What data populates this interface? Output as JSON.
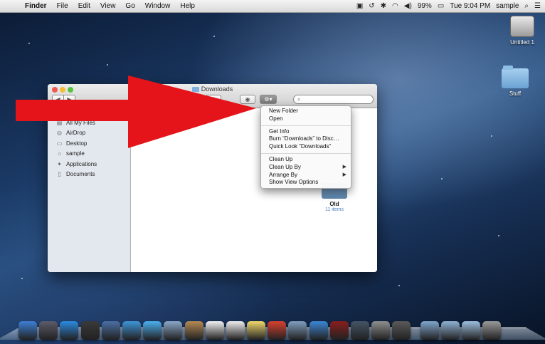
{
  "menubar": {
    "apple_glyph": "",
    "items": [
      "Finder",
      "File",
      "Edit",
      "View",
      "Go",
      "Window",
      "Help"
    ],
    "battery": "99%",
    "clock": "Tue 9:04 PM",
    "user": "sample"
  },
  "desktop": {
    "icons": [
      {
        "label": "Untitled 1",
        "kind": "drive-icon"
      },
      {
        "label": "Stuff",
        "kind": "folder-icon"
      }
    ]
  },
  "finder": {
    "title": "Downloads",
    "sidebar": [
      {
        "label": "All My Files",
        "icon": "all-files-icon"
      },
      {
        "label": "AirDrop",
        "icon": "airdrop-icon"
      },
      {
        "label": "Desktop",
        "icon": "desktop-icon"
      },
      {
        "label": "sample",
        "icon": "home-icon"
      },
      {
        "label": "Applications",
        "icon": "applications-icon"
      },
      {
        "label": "Documents",
        "icon": "documents-icon"
      }
    ],
    "content": {
      "folder_name": "Old",
      "folder_count": "11 items"
    }
  },
  "context_menu": {
    "items": [
      {
        "label": "New Folder"
      },
      {
        "label": "Open"
      },
      {
        "separator": true
      },
      {
        "label": "Get Info"
      },
      {
        "label": "Burn “Downloads” to Disc…"
      },
      {
        "label": "Quick Look “Downloads”"
      },
      {
        "separator": true
      },
      {
        "label": "Clean Up"
      },
      {
        "label": "Clean Up By",
        "submenu": true
      },
      {
        "label": "Arrange By",
        "submenu": true
      },
      {
        "label": "Show View Options"
      }
    ]
  },
  "dock": {
    "icons": [
      {
        "name": "finder",
        "color": "#3d7fd6"
      },
      {
        "name": "launchpad",
        "color": "#5b5b6b"
      },
      {
        "name": "app-store",
        "color": "#2b8ae0"
      },
      {
        "name": "dashboard",
        "color": "#3a3a3a"
      },
      {
        "name": "mission-control",
        "color": "#4a6fa5"
      },
      {
        "name": "safari",
        "color": "#3f95d8"
      },
      {
        "name": "messages",
        "color": "#4bb0f0"
      },
      {
        "name": "mail",
        "color": "#8ba8c8"
      },
      {
        "name": "contacts",
        "color": "#b58a55"
      },
      {
        "name": "calendar",
        "color": "#f2f2f2"
      },
      {
        "name": "reminders",
        "color": "#eeeeee"
      },
      {
        "name": "notes",
        "color": "#f1d96b"
      },
      {
        "name": "chrome",
        "color": "#d8412f"
      },
      {
        "name": "preview",
        "color": "#7f9fbf"
      },
      {
        "name": "itunes",
        "color": "#3d86d4"
      },
      {
        "name": "photo-booth",
        "color": "#8a1e1e"
      },
      {
        "name": "time-machine",
        "color": "#445566"
      },
      {
        "name": "system-preferences",
        "color": "#8f8f8f"
      },
      {
        "name": "imovie",
        "color": "#5a5a5a"
      },
      {
        "name": "applications-stack",
        "color": "#7fa6cc"
      },
      {
        "name": "documents-stack",
        "color": "#8fb2d4"
      },
      {
        "name": "downloads-stack",
        "color": "#9ebfdf"
      },
      {
        "name": "trash",
        "color": "#9a9a9a"
      }
    ]
  }
}
